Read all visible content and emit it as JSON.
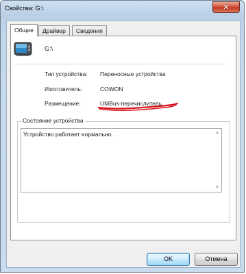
{
  "window": {
    "title": "Свойства: G:\\",
    "close_symbol": "✕"
  },
  "tabs": [
    {
      "label": "Общие",
      "active": true
    },
    {
      "label": "Драйвер",
      "active": false
    },
    {
      "label": "Сведения",
      "active": false
    }
  ],
  "general": {
    "device_icon": "portable-device-icon",
    "device_name": "G:\\",
    "properties": [
      {
        "label": "Тип устройства:",
        "value": "Переносные устройства"
      },
      {
        "label": "Изготовитель:",
        "value": "COWON"
      },
      {
        "label": "Размещение:",
        "value": "UMBus-перечислитель"
      }
    ],
    "status_group_label": "Состояние устройства",
    "status_text": "Устройство работает нормально."
  },
  "buttons": {
    "ok": "OK",
    "cancel": "Отмена"
  },
  "colors": {
    "annotation_red": "#d8141b",
    "titlebar": "#c4d8ec",
    "close_button": "#c23a22"
  }
}
